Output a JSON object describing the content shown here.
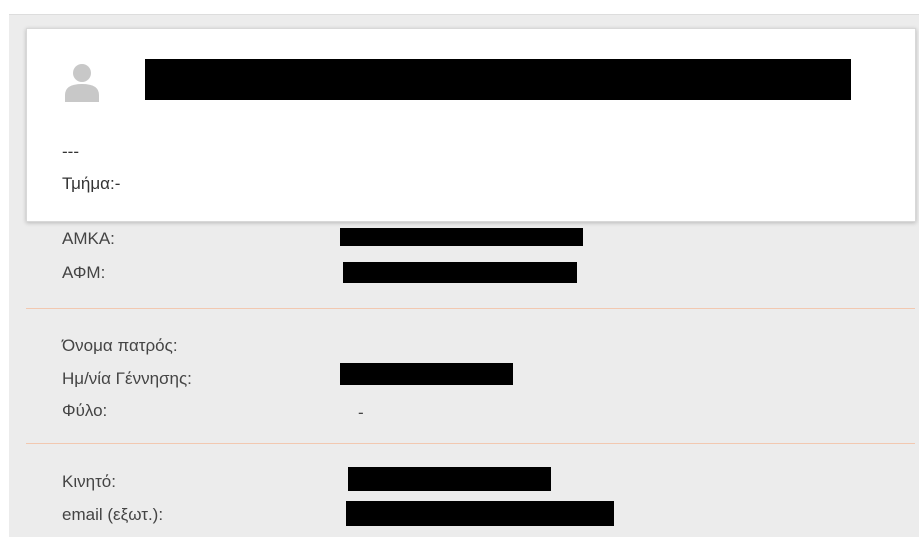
{
  "card": {
    "avatar_icon": "user-silhouette-icon",
    "placeholder": "---",
    "department": "Τμήμα:-"
  },
  "identifiers": {
    "amka_label": "ΑΜΚΑ:",
    "afm_label": "ΑΦΜ:"
  },
  "personal": {
    "father_name_label": "Όνομα πατρός:",
    "birth_date_label": "Ημ/νία Γέννησης:",
    "gender_label": "Φύλο:",
    "gender_value": "-"
  },
  "contact": {
    "mobile_label": "Κινητό:",
    "email_label": "email (εξωτ.):"
  },
  "colors": {
    "background": "#ececec",
    "divider": "#f2c8b0",
    "redaction": "#000000"
  }
}
